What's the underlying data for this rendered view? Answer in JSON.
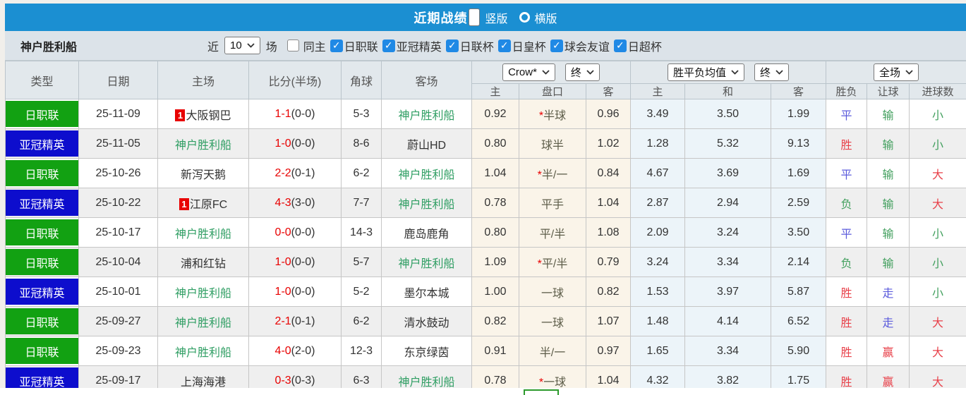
{
  "title_bar": {
    "title": "近期战绩",
    "radio_vertical": "竖版",
    "radio_horizontal": "横版",
    "selected": "竖版"
  },
  "filter_bar": {
    "team": "神户胜利船",
    "recent_label": "近",
    "recent_value": "10",
    "matches_label": "场",
    "checkboxes": [
      {
        "label": "同主",
        "checked": false
      },
      {
        "label": "日职联",
        "checked": true
      },
      {
        "label": "亚冠精英",
        "checked": true
      },
      {
        "label": "日联杯",
        "checked": true
      },
      {
        "label": "日皇杯",
        "checked": true
      },
      {
        "label": "球会友谊",
        "checked": true
      },
      {
        "label": "日超杯",
        "checked": true
      }
    ]
  },
  "table": {
    "selects": {
      "odds_source": "Crow*",
      "asian_time": "终",
      "euro_metric": "胜平负均值",
      "euro_time": "终",
      "scope": "全场"
    },
    "columns": [
      "类型",
      "日期",
      "主场",
      "比分(半场)",
      "角球",
      "客场"
    ],
    "sub_columns": [
      "主",
      "盘口",
      "客",
      "主",
      "和",
      "客",
      "胜负",
      "让球",
      "进球数"
    ],
    "rows": [
      {
        "type": "日职联",
        "type_color": "green",
        "date": "25-11-09",
        "home": "大阪钢巴",
        "home_badge": "1",
        "home_is_team": false,
        "score_ft": "1-1",
        "score_ht": "(0-0)",
        "corners": "5-3",
        "away": "神户胜利船",
        "away_is_team": true,
        "asian": [
          "0.92",
          "半球",
          "0.96"
        ],
        "asian_star": true,
        "euro": [
          "3.49",
          "3.50",
          "1.99"
        ],
        "results": [
          [
            "平",
            "blue"
          ],
          [
            "输",
            "green"
          ],
          [
            "小",
            "green"
          ]
        ]
      },
      {
        "type": "亚冠精英",
        "type_color": "blue",
        "date": "25-11-05",
        "home": "神户胜利船",
        "home_badge": "",
        "home_is_team": true,
        "score_ft": "1-0",
        "score_ht": "(0-0)",
        "corners": "8-6",
        "away": "蔚山HD",
        "away_is_team": false,
        "asian": [
          "0.80",
          "球半",
          "1.02"
        ],
        "asian_star": false,
        "euro": [
          "1.28",
          "5.32",
          "9.13"
        ],
        "results": [
          [
            "胜",
            "red"
          ],
          [
            "输",
            "green"
          ],
          [
            "小",
            "green"
          ]
        ]
      },
      {
        "type": "日职联",
        "type_color": "green",
        "date": "25-10-26",
        "home": "新泻天鹅",
        "home_badge": "",
        "home_is_team": false,
        "score_ft": "2-2",
        "score_ht": "(0-1)",
        "corners": "6-2",
        "away": "神户胜利船",
        "away_is_team": true,
        "asian": [
          "1.04",
          "半/一",
          "0.84"
        ],
        "asian_star": true,
        "euro": [
          "4.67",
          "3.69",
          "1.69"
        ],
        "results": [
          [
            "平",
            "blue"
          ],
          [
            "输",
            "green"
          ],
          [
            "大",
            "red"
          ]
        ]
      },
      {
        "type": "亚冠精英",
        "type_color": "blue",
        "date": "25-10-22",
        "home": "江原FC",
        "home_badge": "1",
        "home_is_team": false,
        "score_ft": "4-3",
        "score_ht": "(3-0)",
        "corners": "7-7",
        "away": "神户胜利船",
        "away_is_team": true,
        "asian": [
          "0.78",
          "平手",
          "1.04"
        ],
        "asian_star": false,
        "euro": [
          "2.87",
          "2.94",
          "2.59"
        ],
        "results": [
          [
            "负",
            "green"
          ],
          [
            "输",
            "green"
          ],
          [
            "大",
            "red"
          ]
        ]
      },
      {
        "type": "日职联",
        "type_color": "green",
        "date": "25-10-17",
        "home": "神户胜利船",
        "home_badge": "",
        "home_is_team": true,
        "score_ft": "0-0",
        "score_ht": "(0-0)",
        "corners": "14-3",
        "away": "鹿岛鹿角",
        "away_is_team": false,
        "asian": [
          "0.80",
          "平/半",
          "1.08"
        ],
        "asian_star": false,
        "euro": [
          "2.09",
          "3.24",
          "3.50"
        ],
        "results": [
          [
            "平",
            "blue"
          ],
          [
            "输",
            "green"
          ],
          [
            "小",
            "green"
          ]
        ]
      },
      {
        "type": "日职联",
        "type_color": "green",
        "date": "25-10-04",
        "home": "浦和红钻",
        "home_badge": "",
        "home_is_team": false,
        "score_ft": "1-0",
        "score_ht": "(0-0)",
        "corners": "5-7",
        "away": "神户胜利船",
        "away_is_team": true,
        "asian": [
          "1.09",
          "平/半",
          "0.79"
        ],
        "asian_star": true,
        "euro": [
          "3.24",
          "3.34",
          "2.14"
        ],
        "results": [
          [
            "负",
            "green"
          ],
          [
            "输",
            "green"
          ],
          [
            "小",
            "green"
          ]
        ]
      },
      {
        "type": "亚冠精英",
        "type_color": "blue",
        "date": "25-10-01",
        "home": "神户胜利船",
        "home_badge": "",
        "home_is_team": true,
        "score_ft": "1-0",
        "score_ht": "(0-0)",
        "corners": "5-2",
        "away": "墨尔本城",
        "away_is_team": false,
        "asian": [
          "1.00",
          "一球",
          "0.82"
        ],
        "asian_star": false,
        "euro": [
          "1.53",
          "3.97",
          "5.87"
        ],
        "results": [
          [
            "胜",
            "red"
          ],
          [
            "走",
            "blue"
          ],
          [
            "小",
            "green"
          ]
        ]
      },
      {
        "type": "日职联",
        "type_color": "green",
        "date": "25-09-27",
        "home": "神户胜利船",
        "home_badge": "",
        "home_is_team": true,
        "score_ft": "2-1",
        "score_ht": "(0-1)",
        "corners": "6-2",
        "away": "清水鼓动",
        "away_is_team": false,
        "asian": [
          "0.82",
          "一球",
          "1.07"
        ],
        "asian_star": false,
        "euro": [
          "1.48",
          "4.14",
          "6.52"
        ],
        "results": [
          [
            "胜",
            "red"
          ],
          [
            "走",
            "blue"
          ],
          [
            "大",
            "red"
          ]
        ]
      },
      {
        "type": "日职联",
        "type_color": "green",
        "date": "25-09-23",
        "home": "神户胜利船",
        "home_badge": "",
        "home_is_team": true,
        "score_ft": "4-0",
        "score_ht": "(2-0)",
        "corners": "12-3",
        "away": "东京绿茵",
        "away_is_team": false,
        "asian": [
          "0.91",
          "半/一",
          "0.97"
        ],
        "asian_star": false,
        "euro": [
          "1.65",
          "3.34",
          "5.90"
        ],
        "results": [
          [
            "胜",
            "red"
          ],
          [
            "赢",
            "red"
          ],
          [
            "大",
            "red"
          ]
        ]
      },
      {
        "type": "亚冠精英",
        "type_color": "blue",
        "date": "25-09-17",
        "home": "上海海港",
        "home_badge": "",
        "home_is_team": false,
        "score_ft": "0-3",
        "score_ht": "(0-3)",
        "corners": "6-3",
        "away": "神户胜利船",
        "away_is_team": true,
        "asian": [
          "0.78",
          "一球",
          "1.04"
        ],
        "asian_star": true,
        "euro": [
          "4.32",
          "3.82",
          "1.75"
        ],
        "results": [
          [
            "胜",
            "red"
          ],
          [
            "赢",
            "red"
          ],
          [
            "大",
            "red"
          ]
        ]
      }
    ]
  },
  "colors": {
    "header_blue": "#1b8fd2",
    "league_green": "#12a112",
    "league_blue": "#0d0dcd",
    "score_red": "#e80000",
    "team_green": "#2f9e63",
    "result_red": "#e8414a",
    "result_green": "#43a05f",
    "result_blue": "#5b5bdc",
    "checkbox_blue": "#2089e5"
  }
}
